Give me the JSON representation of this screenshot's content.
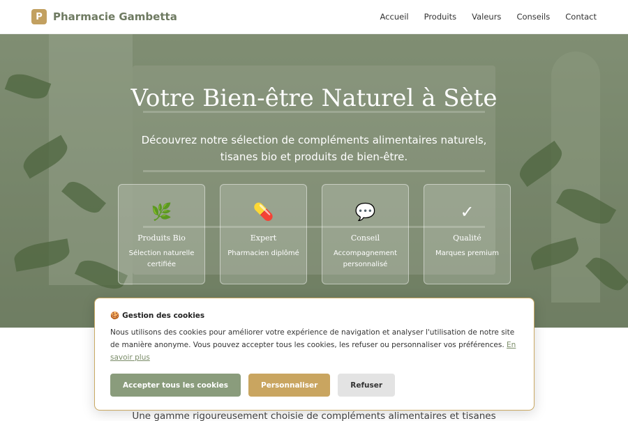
{
  "header": {
    "logo_letter": "P",
    "brand": "Pharmacie Gambetta",
    "nav": [
      "Accueil",
      "Produits",
      "Valeurs",
      "Conseils",
      "Contact"
    ]
  },
  "hero": {
    "title": "Votre Bien-être Naturel à Sète",
    "subtitle": "Découvrez notre sélection de compléments alimentaires naturels, tisanes bio et produits de bien-être.",
    "features": [
      {
        "icon": "herb-icon",
        "glyph": "🌿",
        "title": "Produits Bio",
        "desc": "Sélection naturelle certifiée"
      },
      {
        "icon": "pill-icon",
        "glyph": "💊",
        "title": "Expert",
        "desc": "Pharmacien diplômé"
      },
      {
        "icon": "speech-bubble-icon",
        "glyph": "💬",
        "title": "Conseil",
        "desc": "Accompagnement personnalisé"
      },
      {
        "icon": "checkmark-icon",
        "glyph": "✓",
        "title": "Qualité",
        "desc": "Marques premium"
      }
    ]
  },
  "cookie": {
    "glyph": "🍪",
    "title": "Gestion des cookies",
    "text": "Nous utilisons des cookies pour améliorer votre expérience de navigation et analyser l'utilisation de notre site de manière anonyme. Vous pouvez accepter tous les cookies, les refuser ou personnaliser vos préférences.",
    "link": "En savoir plus",
    "accept": "Accepter tous les cookies",
    "customize": "Personnaliser",
    "refuse": "Refuser"
  },
  "below": {
    "text": "Une gamme rigoureusement choisie de compléments alimentaires et tisanes"
  },
  "colors": {
    "brand": "#6e7a61",
    "gold": "#c9a560",
    "sage": "#8a9c7c"
  }
}
